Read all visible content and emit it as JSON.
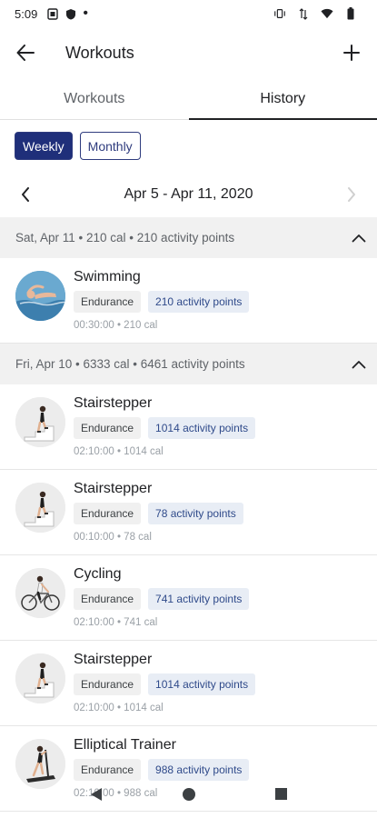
{
  "status_bar": {
    "time": "5:09"
  },
  "app_bar": {
    "title": "Workouts"
  },
  "tabs": [
    {
      "label": "Workouts"
    },
    {
      "label": "History"
    }
  ],
  "period_toggle": {
    "weekly": "Weekly",
    "monthly": "Monthly",
    "selected": "Weekly"
  },
  "date_range": "Apr 5 - Apr 11, 2020",
  "days": [
    {
      "header": "Sat, Apr 11 • 210 cal • 210 activity points",
      "workouts": [
        {
          "name": "Swimming",
          "category": "Endurance",
          "points": "210 activity points",
          "meta": "00:30:00 • 210 cal",
          "icon": "swimmer-icon"
        }
      ]
    },
    {
      "header": "Fri, Apr 10 • 6333 cal • 6461 activity points",
      "workouts": [
        {
          "name": "Stairstepper",
          "category": "Endurance",
          "points": "1014 activity points",
          "meta": "02:10:00 • 1014 cal",
          "icon": "stairstepper-icon"
        },
        {
          "name": "Stairstepper",
          "category": "Endurance",
          "points": "78 activity points",
          "meta": "00:10:00 • 78 cal",
          "icon": "stairstepper-icon"
        },
        {
          "name": "Cycling",
          "category": "Endurance",
          "points": "741 activity points",
          "meta": "02:10:00 • 741 cal",
          "icon": "cyclist-icon"
        },
        {
          "name": "Stairstepper",
          "category": "Endurance",
          "points": "1014 activity points",
          "meta": "02:10:00 • 1014 cal",
          "icon": "stairstepper-icon"
        },
        {
          "name": "Elliptical Trainer",
          "category": "Endurance",
          "points": "988 activity points",
          "meta": "02:10:00 • 988 cal",
          "icon": "elliptical-icon"
        }
      ]
    }
  ],
  "colors": {
    "primary": "#1f2f7a",
    "chip_points_bg": "#e8edf5",
    "day_header_bg": "#f1f1f1"
  }
}
